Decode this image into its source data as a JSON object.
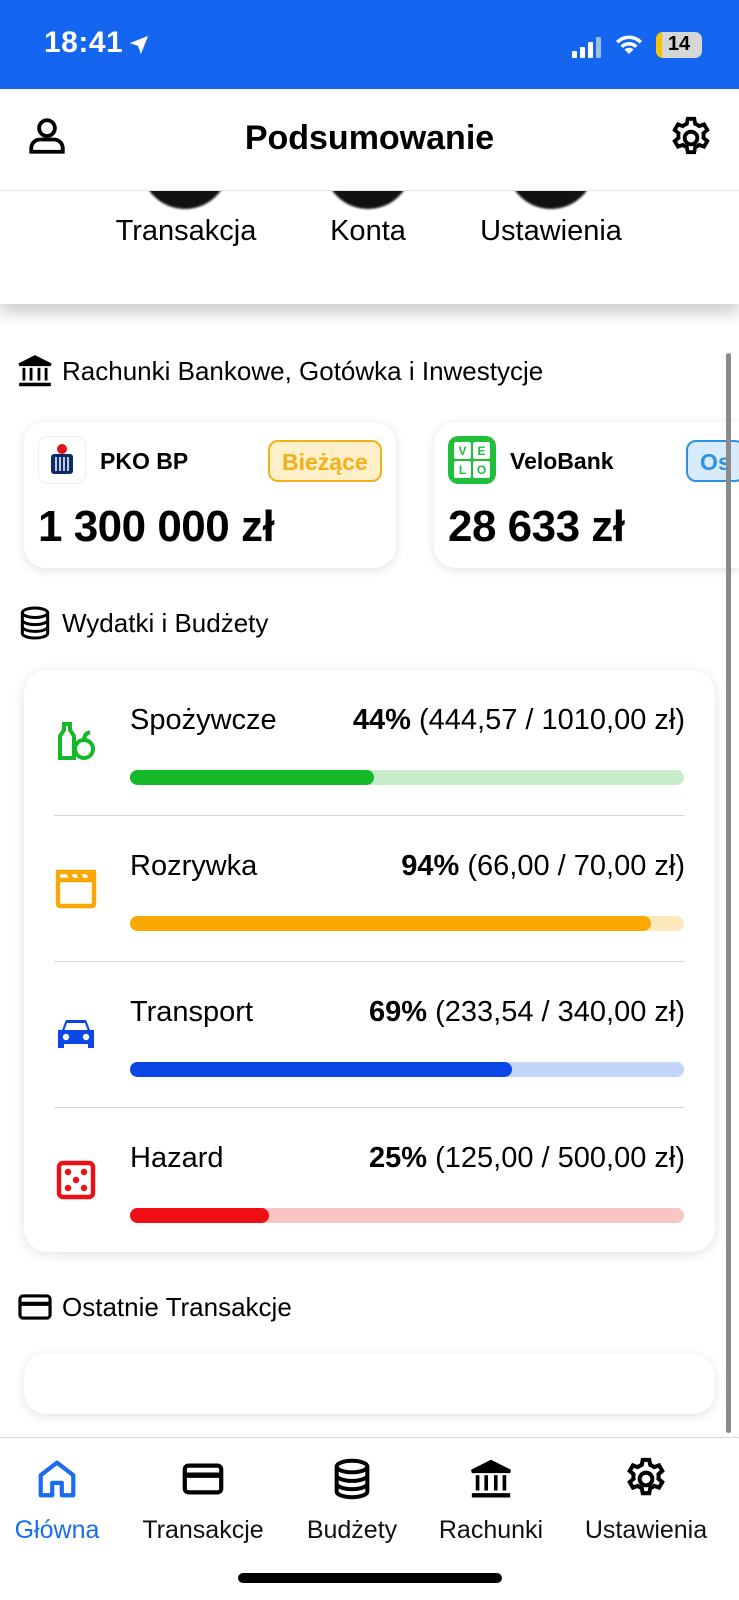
{
  "status_bar": {
    "time": "18:41",
    "battery_level": "14",
    "battery_fraction": 0.14,
    "bar_color": "#1466f0",
    "battery_color": "#f3c400"
  },
  "header": {
    "title": "Podsumowanie",
    "left_icon": "person-icon",
    "right_icon": "gear-icon"
  },
  "quick_actions": [
    {
      "label": "Transakcja"
    },
    {
      "label": "Konta"
    },
    {
      "label": "Ustawienia"
    }
  ],
  "accounts_section": {
    "title": "Rachunki Bankowe, Gotówka i Inwestycje",
    "icon": "bank-icon",
    "accounts": [
      {
        "name": "PKO BP",
        "badge": "Bieżące",
        "balance": "1 300 000 zł",
        "badge_color": "#f3b01a",
        "badge_bg": "#fdf0c8"
      },
      {
        "name": "VeloBank",
        "badge": "Os",
        "balance": "28 633 zł",
        "badge_color": "#2f8fe0",
        "badge_bg": "#d7ebfb"
      }
    ]
  },
  "budgets_section": {
    "title": "Wydatki i Budżety",
    "icon": "database-icon",
    "items": [
      {
        "name": "Spożywcze",
        "percent": "44%",
        "detail": "(444,57 / 1010,00 zł)",
        "progress": 0.44,
        "color": "#13b927",
        "track": "#c6ecc9",
        "icon": "groceries-icon"
      },
      {
        "name": "Rozrywka",
        "percent": "94%",
        "detail": "(66,00 / 70,00 zł)",
        "progress": 0.94,
        "color": "#fba900",
        "track": "#fde7bd",
        "icon": "clapperboard-icon"
      },
      {
        "name": "Transport",
        "percent": "69%",
        "detail": "(233,54 / 340,00 zł)",
        "progress": 0.69,
        "color": "#0a47e6",
        "track": "#c3d5f8",
        "icon": "car-icon"
      },
      {
        "name": "Hazard",
        "percent": "25%",
        "detail": "(125,00 / 500,00 zł)",
        "progress": 0.25,
        "color": "#ee0e14",
        "track": "#f8c4c4",
        "icon": "dice-icon"
      }
    ]
  },
  "transactions_section": {
    "title": "Ostatnie Transakcje",
    "icon": "credit-card-icon"
  },
  "tab_bar": {
    "active_color": "#1a6cf0",
    "items": [
      {
        "label": "Główna",
        "icon": "home-icon",
        "active": true
      },
      {
        "label": "Transakcje",
        "icon": "credit-card-icon",
        "active": false
      },
      {
        "label": "Budżety",
        "icon": "database-icon",
        "active": false
      },
      {
        "label": "Rachunki",
        "icon": "bank-icon",
        "active": false
      },
      {
        "label": "Ustawienia",
        "icon": "gear-icon",
        "active": false
      }
    ]
  }
}
